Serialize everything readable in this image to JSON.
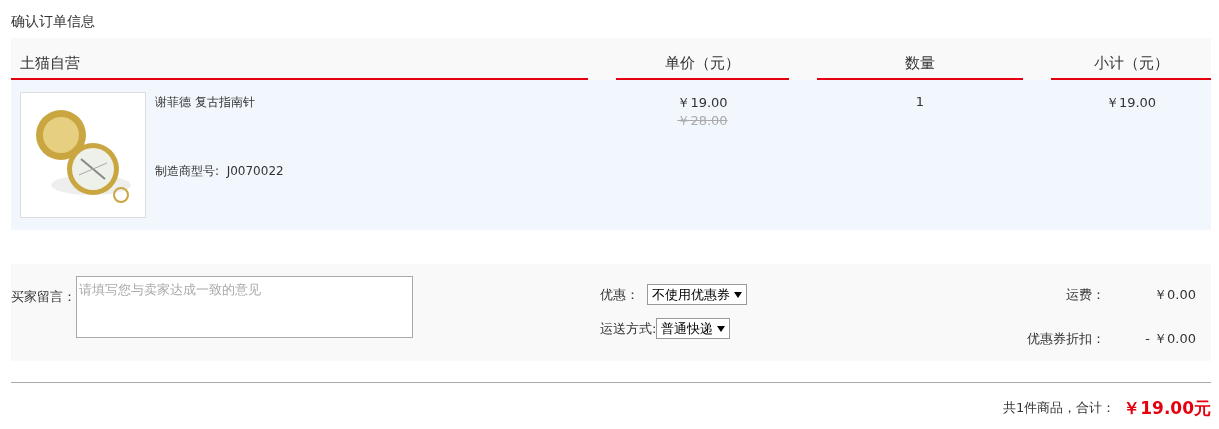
{
  "title": "确认订单信息",
  "table": {
    "columns": [
      "土猫自营",
      "单价（元）",
      "数量",
      "小计（元）"
    ],
    "rows": [
      {
        "name": "谢菲德 复古指南针",
        "model": "制造商型号:  J0070022",
        "price": "￥19.00",
        "original_price": "￥28.00",
        "quantity": "1",
        "subtotal": "￥19.00"
      }
    ]
  },
  "options": {
    "message_label": "买家留言：",
    "message_placeholder": "请填写您与卖家达成一致的意见",
    "coupon_label": "优惠：",
    "coupon_value": "不使用优惠券",
    "shipping_label": "运送方式:",
    "shipping_value": "普通快递",
    "fees": [
      {
        "label": "运费：",
        "value": "￥0.00"
      },
      {
        "label": "优惠券折扣：",
        "value": "- ￥0.00"
      }
    ]
  },
  "summary": {
    "label": "共1件商品，合计：",
    "total": "￥19.00元"
  }
}
